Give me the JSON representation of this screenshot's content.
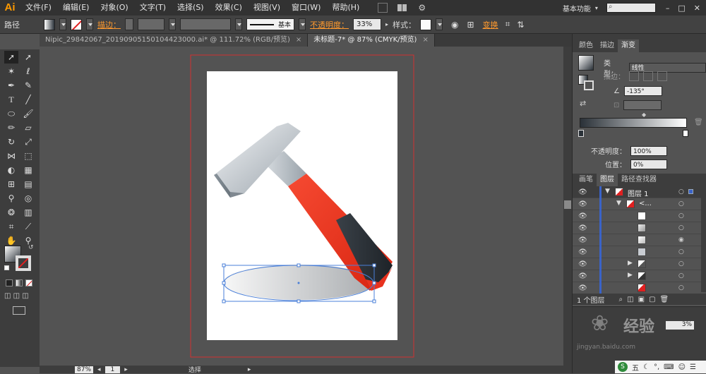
{
  "app": {
    "logo": "Ai"
  },
  "menu": [
    "文件(F)",
    "编辑(E)",
    "对象(O)",
    "文字(T)",
    "选择(S)",
    "效果(C)",
    "视图(V)",
    "窗口(W)",
    "帮助(H)"
  ],
  "workspace": {
    "label": "基本功能"
  },
  "control_bar": {
    "object_type": "路径",
    "stroke_label": "描边：",
    "stroke_profile": "基本",
    "opacity_label": "不透明度：",
    "opacity_value": "33%",
    "style_label": "样式：",
    "transform_label": "变换"
  },
  "tabs": [
    {
      "title": "Nipic_29842067_20190905150104423000.ai* @ 111.72% (RGB/预览)",
      "active": false
    },
    {
      "title": "未标题-7* @ 87% (CMYK/预览)",
      "active": true
    }
  ],
  "status": {
    "zoom": "87%",
    "page": "1",
    "tool": "选择"
  },
  "gradient_panel": {
    "tabs": [
      "颜色",
      "描边",
      "渐变"
    ],
    "type_label": "类型：",
    "type_value": "线性",
    "stroke_label": "描边：",
    "angle_value": "-135°",
    "opacity_label": "不透明度：",
    "opacity_value": "100%",
    "position_label": "位置：",
    "position_value": "0%"
  },
  "layers_panel": {
    "tabs": [
      "画笔",
      "图层",
      "路径查找器"
    ],
    "layer_name": "图层 1",
    "group_name": "<...",
    "footer_count": "1 个图层"
  },
  "watermark": {
    "text": "经验",
    "sub": "jingyan.baidu.com"
  },
  "taskbar": {
    "ime_label": "五"
  },
  "colors": {
    "accent": "#ff9a00",
    "handle_red": "#e8321e",
    "layer_highlight": "#3a63c8",
    "artboard_border": "#d23030"
  }
}
